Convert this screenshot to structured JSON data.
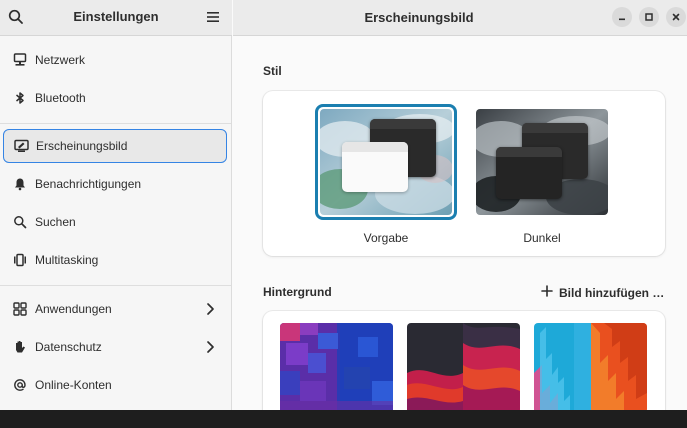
{
  "sidebar": {
    "title": "Einstellungen",
    "items": [
      {
        "label": "Netzwerk",
        "icon": "network-icon"
      },
      {
        "label": "Bluetooth",
        "icon": "bluetooth-icon"
      },
      {
        "label": "Erscheinungsbild",
        "icon": "appearance-icon",
        "selected": true
      },
      {
        "label": "Benachrichtigungen",
        "icon": "bell-icon"
      },
      {
        "label": "Suchen",
        "icon": "search-icon"
      },
      {
        "label": "Multitasking",
        "icon": "multitasking-icon"
      },
      {
        "label": "Anwendungen",
        "icon": "apps-icon",
        "has_chevron": true
      },
      {
        "label": "Datenschutz",
        "icon": "hand-icon",
        "has_chevron": true
      },
      {
        "label": "Online-Konten",
        "icon": "at-icon"
      }
    ]
  },
  "main": {
    "title": "Erscheinungsbild",
    "style_section": {
      "title": "Stil",
      "options": [
        {
          "label": "Vorgabe",
          "selected": true
        },
        {
          "label": "Dunkel",
          "selected": false
        }
      ]
    },
    "background_section": {
      "title": "Hintergrund",
      "add_label": "Bild hinzufügen …"
    }
  },
  "colors": {
    "accent": "#3584e4",
    "selection_border": "#1b7fb0",
    "sidebar_bg": "#f6f6f6",
    "header_bg": "#ebebeb"
  }
}
